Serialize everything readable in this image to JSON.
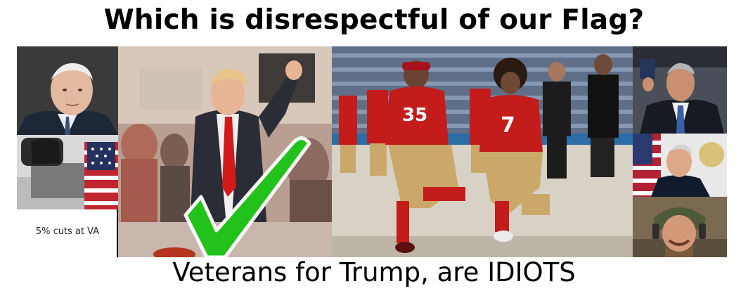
{
  "title": "Which is disrespectful of our Flag?",
  "caption": "Veterans for Trump, are IDIOTS",
  "side_label": "5% cuts at VA",
  "colors": {
    "checkmark": "#22c21a",
    "jersey_red": "#c41b1b",
    "pants_gold": "#c9a86a"
  },
  "icons": [
    "checkmark-icon"
  ]
}
